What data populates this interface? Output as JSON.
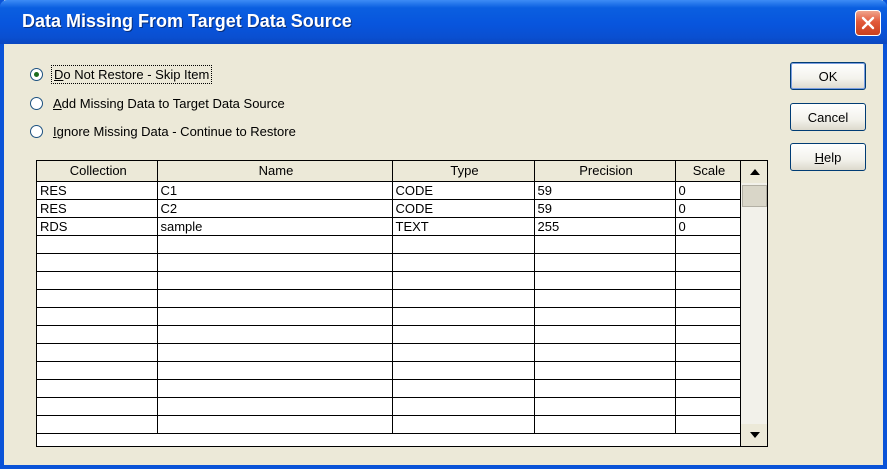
{
  "window": {
    "title": "Data Missing From Target Data Source"
  },
  "options": [
    {
      "prefix": "",
      "accel": "D",
      "rest": "o Not Restore - Skip Item",
      "checked": true
    },
    {
      "prefix": "",
      "accel": "A",
      "rest": "dd Missing Data to Target Data Source",
      "checked": false
    },
    {
      "prefix": "",
      "accel": "I",
      "rest": "gnore Missing Data - Continue to Restore",
      "checked": false
    }
  ],
  "buttons": {
    "ok": {
      "label": "OK"
    },
    "cancel": {
      "label": "Cancel"
    },
    "help": {
      "accel": "H",
      "rest": "elp"
    }
  },
  "table": {
    "columns": [
      "Collection",
      "Name",
      "Type",
      "Precision",
      "Scale"
    ],
    "rows": [
      [
        "RES",
        "C1",
        "CODE",
        "59",
        "0"
      ],
      [
        "RES",
        "C2",
        "CODE",
        "59",
        "0"
      ],
      [
        "RDS",
        "sample",
        "TEXT",
        "255",
        "0"
      ],
      [
        "",
        "",
        "",
        "",
        ""
      ],
      [
        "",
        "",
        "",
        "",
        ""
      ],
      [
        "",
        "",
        "",
        "",
        ""
      ],
      [
        "",
        "",
        "",
        "",
        ""
      ],
      [
        "",
        "",
        "",
        "",
        ""
      ],
      [
        "",
        "",
        "",
        "",
        ""
      ],
      [
        "",
        "",
        "",
        "",
        ""
      ],
      [
        "",
        "",
        "",
        "",
        ""
      ],
      [
        "",
        "",
        "",
        "",
        ""
      ],
      [
        "",
        "",
        "",
        "",
        ""
      ],
      [
        "",
        "",
        "",
        "",
        ""
      ]
    ]
  },
  "icons": {
    "close": "close-icon",
    "scroll_up": "scroll-up-arrow-icon",
    "scroll_down": "scroll-down-arrow-icon"
  },
  "colors": {
    "titlebar": "#0855dd",
    "dialog_bg": "#ece9d8",
    "close_button": "#e2593a"
  }
}
